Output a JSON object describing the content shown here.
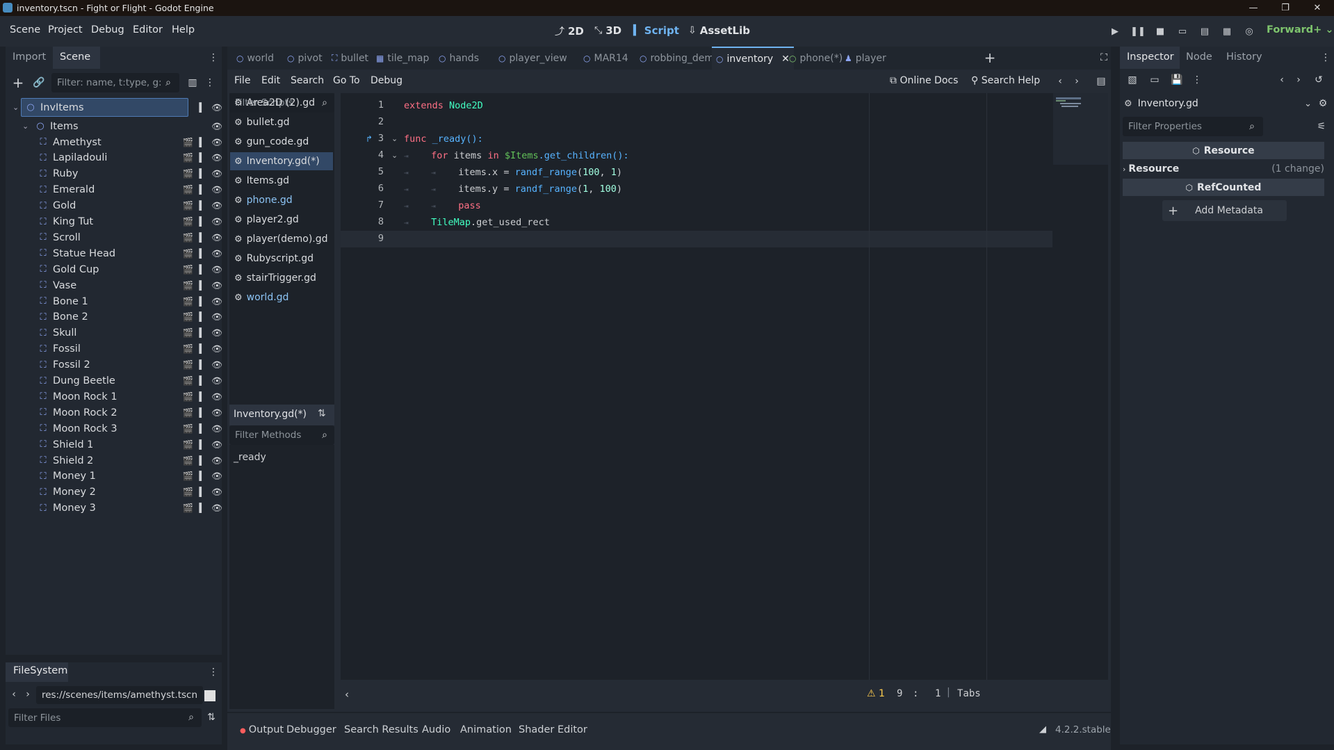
{
  "window": {
    "title": "inventory.tscn - Fight or Flight - Godot Engine"
  },
  "menu": [
    "Scene",
    "Project",
    "Debug",
    "Editor",
    "Help"
  ],
  "workspaces": [
    {
      "label": "2D",
      "icon": "2d-icon"
    },
    {
      "label": "3D",
      "icon": "3d-icon"
    },
    {
      "label": "Script",
      "icon": "script-icon",
      "active": true
    },
    {
      "label": "AssetLib",
      "icon": "assetlib-icon"
    }
  ],
  "renderer": "Forward+",
  "scene_dock": {
    "tabs": [
      "Import",
      "Scene"
    ],
    "filter_placeholder": "Filter: name, t:type, g:",
    "root": "InvItems",
    "items_node": "Items",
    "children": [
      "Amethyst",
      "Lapiladouli",
      "Ruby",
      "Emerald",
      "Gold",
      "King Tut",
      "Scroll",
      "Statue Head",
      "Gold Cup",
      "Vase",
      "Bone 1",
      "Bone 2",
      "Skull",
      "Fossil",
      "Fossil 2",
      "Dung Beetle",
      "Moon Rock 1",
      "Moon Rock 2",
      "Moon Rock 3",
      "Shield 1",
      "Shield 2",
      "Money 1",
      "Money 2",
      "Money 3"
    ]
  },
  "filesystem": {
    "tab": "FileSystem",
    "path": "res://scenes/items/amethyst.tscn",
    "filter_placeholder": "Filter Files"
  },
  "scene_tabs": [
    "world",
    "pivot",
    "bullet",
    "tile_map",
    "hands",
    "player_view",
    "MAR14",
    "robbing_demo",
    "inventory",
    "phone(*)",
    "player"
  ],
  "script_menu": [
    "File",
    "Edit",
    "Search",
    "Go To",
    "Debug"
  ],
  "script_toolbar": {
    "online_docs": "Online Docs",
    "search_help": "Search Help"
  },
  "scripts": {
    "filter_placeholder": "Filter Scripts",
    "list": [
      "Area2D (2).gd",
      "bullet.gd",
      "gun_code.gd",
      "Inventory.gd(*)",
      "Items.gd",
      "phone.gd",
      "player2.gd",
      "player(demo).gd",
      "Rubyscript.gd",
      "stairTrigger.gd",
      "world.gd"
    ],
    "current": "Inventory.gd(*)",
    "methods_filter_placeholder": "Filter Methods",
    "methods": [
      "_ready"
    ]
  },
  "code": {
    "line_numbers": [
      "1",
      "2",
      "3",
      "4",
      "5",
      "6",
      "7",
      "8",
      "9"
    ],
    "l1": {
      "kw": "extends",
      "cls": "Node2D"
    },
    "l3": {
      "kw": "func",
      "fn": "_ready():"
    },
    "l4": {
      "kw1": "for",
      "var": "items",
      "kw2": "in",
      "node": "$Items",
      "call": ".get_children():"
    },
    "l5": {
      "var": "items.x",
      "op": " = ",
      "fn": "randf_range",
      "args_open": "(",
      "a1": "100",
      "sep": ", ",
      "a2": "1",
      "args_close": ")"
    },
    "l6": {
      "var": "items.y",
      "op": " = ",
      "fn": "randf_range",
      "args_open": "(",
      "a1": "1",
      "sep": ", ",
      "a2": "100",
      "args_close": ")"
    },
    "l7": {
      "kw": "pass"
    },
    "l8": {
      "cls": "TileMap",
      "rest": ".get_used_rect"
    }
  },
  "status": {
    "warnings": "1",
    "line": "9",
    "col_sep": ":",
    "col": "1",
    "indent": "Tabs"
  },
  "bottom_tabs": [
    "Output",
    "Debugger",
    "Search Results",
    "Audio",
    "Animation",
    "Shader Editor"
  ],
  "version": "4.2.2.stable",
  "inspector": {
    "tabs": [
      "Inspector",
      "Node",
      "History"
    ],
    "resource": "Inventory.gd",
    "filter_placeholder": "Filter Properties",
    "section_resource": "Resource",
    "group_resource": "Resource",
    "group_changes": "(1 change)",
    "section_refcounted": "RefCounted",
    "add_metadata": "Add Metadata"
  },
  "colors": {
    "accent": "#6fb3f0",
    "selected": "#324866",
    "renderer": "#7ec46d"
  }
}
